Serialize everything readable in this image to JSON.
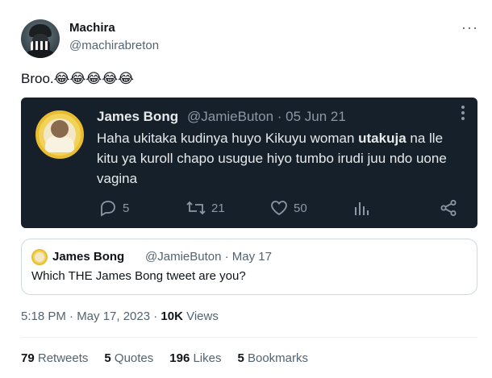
{
  "author": {
    "name": "Machira",
    "handle": "@machirabreton"
  },
  "more_label": "···",
  "tweet_text": "Broo.😂😂😂😂😂",
  "screenshot": {
    "name": "James Bong",
    "meta": "@JamieButon · 05 Jun 21",
    "text_part1": "Haha ukitaka kudinya huyo Kikuyu woman ",
    "text_bold": "utakuja",
    "text_part2": " na lle kitu ya kuroll chapo usugue hiyo tumbo irudi juu ndo uone vagina",
    "actions": {
      "replies": "5",
      "retweets": "21",
      "likes": "50"
    }
  },
  "quoted": {
    "name": "James Bong",
    "meta": "@JamieButon · May 17",
    "text": "Which THE James Bong tweet are you?"
  },
  "timestamp": {
    "time_date": "5:18 PM · May 17, 2023 · ",
    "views_count": "10K",
    "views_label": " Views"
  },
  "stats": {
    "retweets_count": "79",
    "retweets_label": " Retweets",
    "quotes_count": "5",
    "quotes_label": " Quotes",
    "likes_count": "196",
    "likes_label": " Likes",
    "bookmarks_count": "5",
    "bookmarks_label": " Bookmarks"
  },
  "icons": [
    "reply-icon",
    "retweet-icon",
    "like-icon",
    "views-icon",
    "share-icon",
    "more-icon"
  ],
  "colors": {
    "text": "#0f1419",
    "muted": "#536471",
    "embed_bg": "#15202b",
    "embed_text": "#e7e9ea",
    "embed_muted": "#8b98a5",
    "border": "#cfd9de"
  }
}
